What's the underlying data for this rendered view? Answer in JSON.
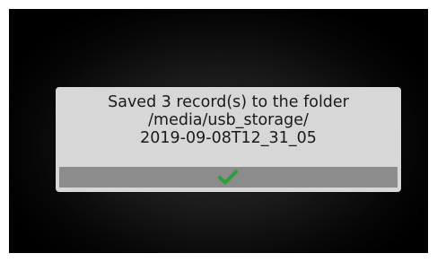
{
  "dialog": {
    "message_line_1": "Saved 3 record(s) to the folder",
    "message_line_2": "/media/usb_storage/",
    "message_line_3": "2019-09-08T12_31_05",
    "confirm_icon": "checkmark-icon",
    "confirm_icon_color": "#2e9e3a"
  },
  "colors": {
    "dialog_background": "#d7d7d7",
    "button_background": "#8c8c8c",
    "screen_background": "#000000"
  }
}
